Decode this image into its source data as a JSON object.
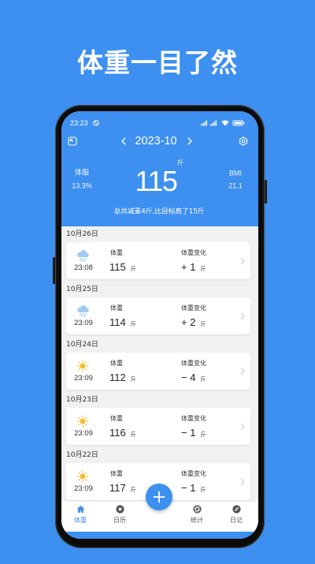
{
  "promo": {
    "headline": "体重一目了然"
  },
  "status_bar": {
    "time": "23:23"
  },
  "nav": {
    "month": "2023-10"
  },
  "summary": {
    "body_fat_label": "体脂",
    "body_fat_value": "13.3%",
    "weight_value": "115",
    "weight_unit": "斤",
    "bmi_label": "BMI",
    "bmi_value": "21.1",
    "note": "总共减重4斤,比目标高了15斤"
  },
  "records": [
    {
      "date": "10月26日",
      "weather_icon": "snow-cloud-icon",
      "time": "23:08",
      "weight_label": "体重",
      "weight": "115",
      "weight_unit": "斤",
      "change_label": "体重变化",
      "change": "+ 1",
      "change_unit": "斤"
    },
    {
      "date": "10月25日",
      "weather_icon": "snow-cloud-icon",
      "time": "23:09",
      "weight_label": "体重",
      "weight": "114",
      "weight_unit": "斤",
      "change_label": "体重变化",
      "change": "+ 2",
      "change_unit": "斤"
    },
    {
      "date": "10月24日",
      "weather_icon": "sun-icon",
      "time": "23:09",
      "weight_label": "体重",
      "weight": "112",
      "weight_unit": "斤",
      "change_label": "体重变化",
      "change": "− 4",
      "change_unit": "斤"
    },
    {
      "date": "10月23日",
      "weather_icon": "sun-icon",
      "time": "23:09",
      "weight_label": "体重",
      "weight": "116",
      "weight_unit": "斤",
      "change_label": "体重变化",
      "change": "− 1",
      "change_unit": "斤"
    },
    {
      "date": "10月22日",
      "weather_icon": "sun-icon",
      "time": "23:09",
      "weight_label": "体重",
      "weight": "117",
      "weight_unit": "斤",
      "change_label": "体重变化",
      "change": "− 1",
      "change_unit": "斤"
    }
  ],
  "tabs": [
    {
      "label": "体重",
      "icon": "home-icon",
      "active": true
    },
    {
      "label": "日历",
      "icon": "star-circle-icon",
      "active": false
    },
    {
      "label": "统计",
      "icon": "aperture-icon",
      "active": false
    },
    {
      "label": "日记",
      "icon": "compass-icon",
      "active": false
    }
  ],
  "colors": {
    "brand_blue": "#3d8ff0",
    "list_background": "#f1f1f1",
    "card_background": "#ffffff",
    "sun": "#f7be2e",
    "cloud": "#9fcbf3",
    "tab_inactive": "#555555"
  }
}
